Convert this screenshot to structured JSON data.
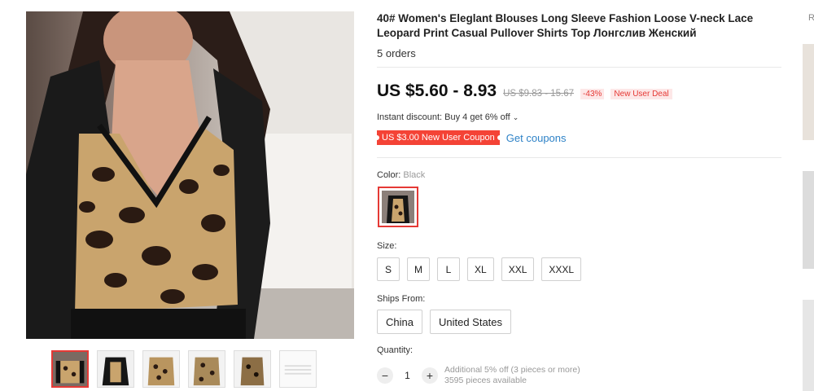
{
  "product": {
    "title": "40# Women's Eleglant Blouses Long Sleeve Fashion Loose V-neck Lace Leopard Print Casual Pullover Shirts Top Лонгслив Женский",
    "orders": "5 orders"
  },
  "price": {
    "current": "US $5.60 - 8.93",
    "original": "US $9.83 - 15.67",
    "discount": "-43%",
    "deal": "New User Deal"
  },
  "instant_discount": "Instant discount: Buy 4 get 6% off",
  "instant_discount_icon": "chevron-down-icon",
  "coupon": {
    "label": "US $3.00 New User Coupon",
    "link": "Get coupons"
  },
  "color": {
    "label": "Color:",
    "value": "Black"
  },
  "size": {
    "label": "Size:",
    "options": [
      "S",
      "M",
      "L",
      "XL",
      "XXL",
      "XXXL"
    ]
  },
  "ships_from": {
    "label": "Ships From:",
    "options": [
      "China",
      "United States"
    ]
  },
  "quantity": {
    "label": "Quantity:",
    "minus": "−",
    "value": "1",
    "plus": "+",
    "note_line1": "Additional 5% off (3 pieces or more)",
    "note_line2": "3595 pieces available"
  },
  "recommendations_label": "R",
  "colors": {
    "accent_red": "#e53935",
    "link_blue": "#2e82c7"
  }
}
